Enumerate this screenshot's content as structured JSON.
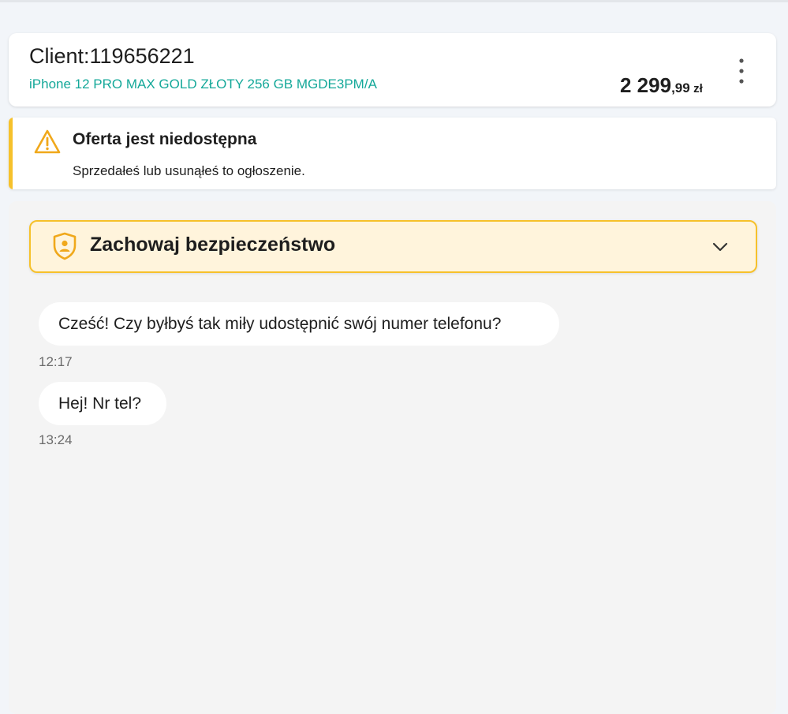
{
  "header": {
    "client_name": "Client:119656221",
    "product_title": "iPhone 12 PRO MAX GOLD ZŁOTY 256 GB MGDE3PM/A",
    "price_main": "2 299",
    "price_decimal": ",99",
    "price_currency": "zł",
    "menu_icon": "more-vertical-icon"
  },
  "alert": {
    "icon": "warning-triangle-icon",
    "title": "Oferta jest niedostępna",
    "description": "Sprzedałeś lub usunąłeś to ogłoszenie."
  },
  "safety": {
    "icon": "shield-user-icon",
    "label": "Zachowaj bezpieczeństwo",
    "toggle_icon": "chevron-down-icon"
  },
  "messages": [
    {
      "text": "Cześć! Czy byłbyś tak miły udostępnić swój numer telefonu?",
      "time": "12:17"
    },
    {
      "text": "Hej! Nr tel?",
      "time": "13:24"
    }
  ],
  "colors": {
    "accent_teal": "#14a899",
    "warning_yellow": "#f6c12b",
    "safety_background": "#fff4dc",
    "page_background": "#f2f5f9",
    "chat_background": "#f4f4f4"
  }
}
